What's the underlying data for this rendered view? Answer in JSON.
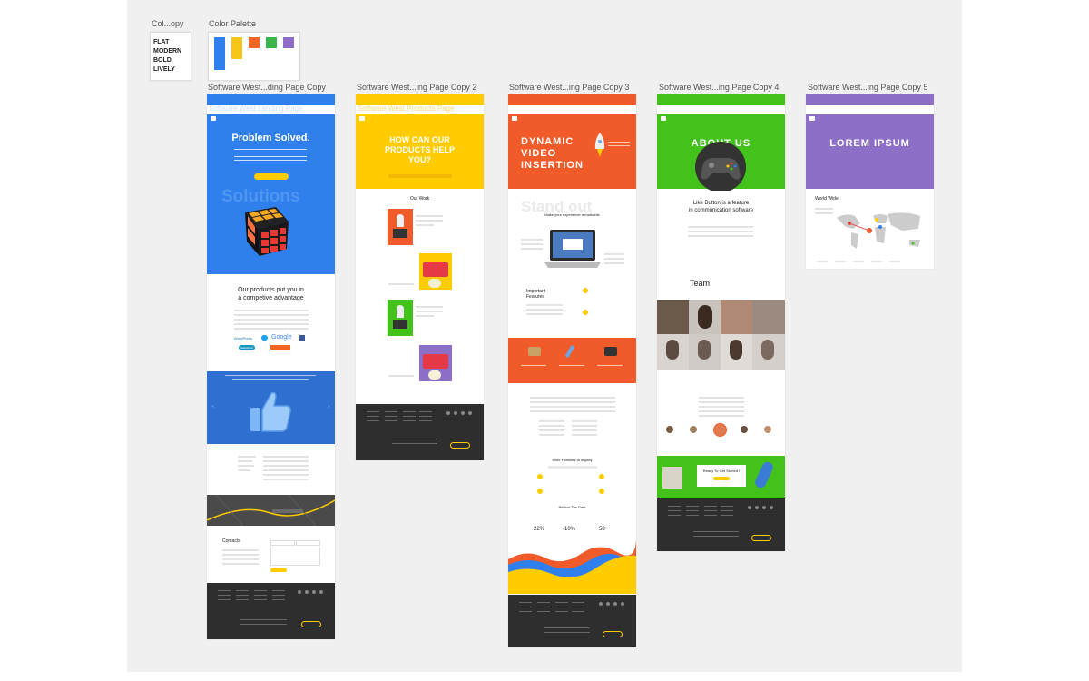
{
  "labels": {
    "cover": "Col...opy",
    "palette": "Color Palette",
    "board1": "Software West...ding Page Copy",
    "board2": "Software West...ing Page Copy 2",
    "board3": "Software West...ing Page Copy 3",
    "board4": "Software West...ing Page Copy 4",
    "board5": "Software West...ing Page Copy 5",
    "sub1": "Software West Landing Page",
    "sub2": "Software West Products Page"
  },
  "cover_words": [
    "FLAT",
    "MODERN",
    "BOLD",
    "LIVELY"
  ],
  "palette_colors": [
    "#2f80ed",
    "#f5c518",
    "#f26522",
    "#39b54a",
    "#8e6bc8"
  ],
  "colors": {
    "blue": "#2f80ed",
    "yellow": "#ffcc00",
    "orange": "#f15a29",
    "green": "#44c21c",
    "purple": "#8e6fc7",
    "dark": "#2e2e2e"
  },
  "board1": {
    "hero_title": "Problem Solved.",
    "watermark": "Solutions",
    "section_title_1": "Our products put you in",
    "section_title_2": "a competive advantage",
    "logos": [
      "WordPress",
      "Google",
      "Salesforce"
    ],
    "contact": "Contacts"
  },
  "board2": {
    "hero_title_1": "HOW CAN OUR",
    "hero_title_2": "PRODUCTS HELP",
    "hero_title_3": "YOU?",
    "work_title": "Our Work"
  },
  "board3": {
    "hero_title_1": "DYNAMIC",
    "hero_title_2": "VIDEO",
    "hero_title_3": "INSERTION",
    "watermark": "Stand out",
    "tagline": "Make your experience remarkable",
    "features_1": "Important",
    "features_2": "Features",
    "more_features": "More Features to display",
    "behind": "Behind The Data",
    "stats": [
      "22%",
      "-10%",
      "58"
    ]
  },
  "board4": {
    "hero_title": "ABOUT US",
    "feature_1": "Like Button is a feature",
    "feature_2": "in communication software",
    "team": "Team",
    "cta": "Ready To Get Started?"
  },
  "board5": {
    "hero_title": "LOREM IPSUM",
    "map_title": "World Wide"
  }
}
